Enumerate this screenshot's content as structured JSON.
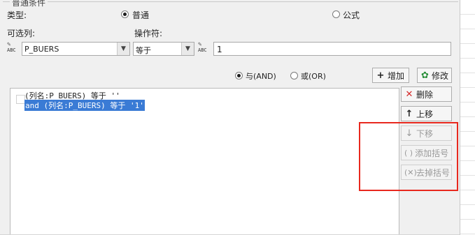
{
  "group": {
    "title": "普通条件"
  },
  "type_row": {
    "label": "类型:",
    "options": [
      {
        "label": "普通",
        "checked": true
      },
      {
        "label": "公式",
        "checked": false
      }
    ]
  },
  "columns_label": "可选列:",
  "operator_label": "操作符:",
  "column_combo": {
    "icon": "abc-field-icon",
    "value": "P_BUERS"
  },
  "operator_combo": {
    "value": "等于"
  },
  "value_field": {
    "icon": "abc-field-icon",
    "value": "1"
  },
  "logic": {
    "and_label": "与(AND)",
    "and_checked": true,
    "or_label": "或(OR)",
    "or_checked": false
  },
  "buttons": {
    "add": {
      "label": "增加",
      "icon": "plus-icon"
    },
    "modify": {
      "label": "修改",
      "icon": "edit-icon"
    },
    "delete": {
      "label": "删除",
      "icon": "x-icon"
    },
    "move_up": {
      "label": "上移",
      "icon": "arrow-up-icon"
    },
    "move_down": {
      "label": "下移",
      "icon": "arrow-down-icon"
    },
    "add_bracket": {
      "label": "添加括号",
      "icon": "bracket-icon"
    },
    "remove_bracket": {
      "label": "去掉括号",
      "icon": "bracket-remove-icon"
    }
  },
  "conditions": [
    {
      "text": "(列名:P_BUERS) 等于 ''",
      "selected": false
    },
    {
      "text": "and (列名:P_BUERS) 等于 '1'",
      "selected": true
    }
  ],
  "colors": {
    "selection": "#3a7bd5",
    "highlight": "#e8281e",
    "delete_icon": "#d42a2a"
  }
}
